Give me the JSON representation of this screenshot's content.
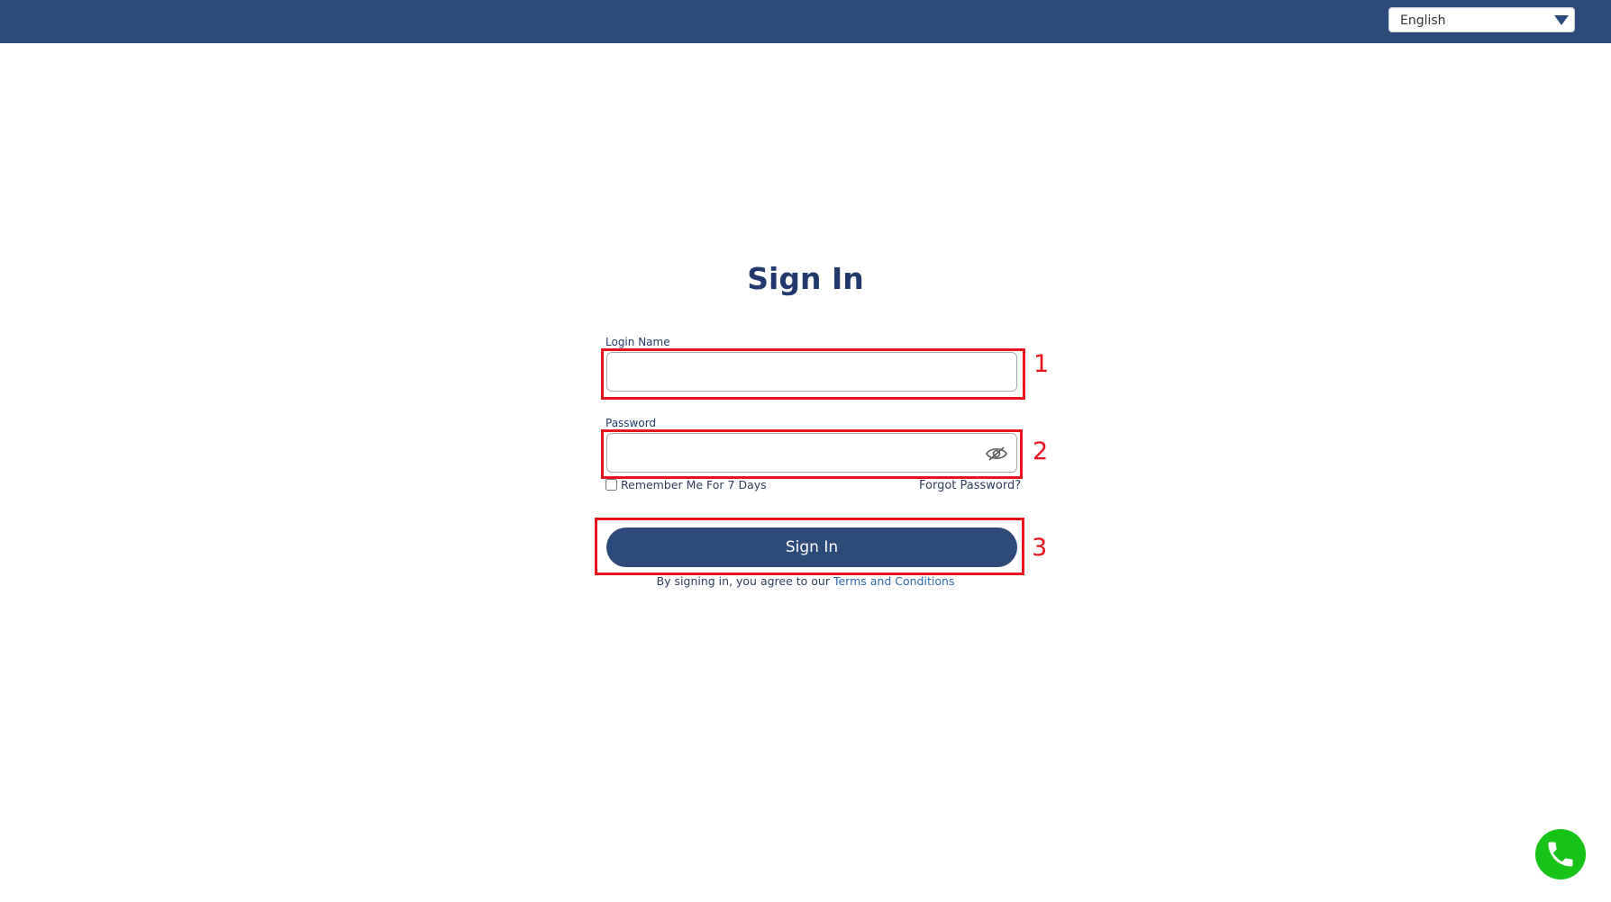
{
  "header": {
    "language_selected": "English",
    "brand_color": "#2e4a79"
  },
  "page": {
    "title": "Sign In"
  },
  "form": {
    "login_label": "Login Name",
    "login_value": "",
    "password_label": "Password",
    "password_value": "",
    "remember_label": "Remember Me For 7 Days",
    "remember_checked": false,
    "forgot_label": "Forgot Password?",
    "submit_label": "Sign In",
    "terms_prefix": "By signing in, you agree to our ",
    "terms_link": "Terms and Conditions"
  },
  "annotations": {
    "marker_color": "#e8141c",
    "labels": [
      "1",
      "2",
      "3"
    ]
  },
  "floating": {
    "call_icon": "phone-icon",
    "call_color": "#17c317"
  }
}
